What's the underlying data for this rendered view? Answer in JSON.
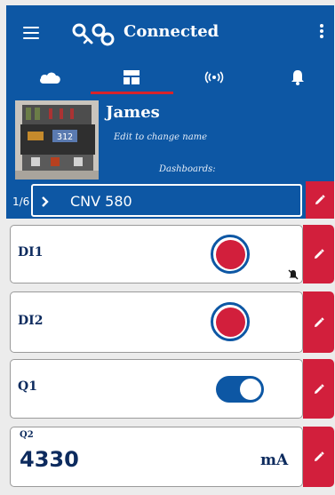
{
  "appbar": {
    "title": "Connected"
  },
  "tabs": [
    {
      "id": "cloud",
      "icon": "cloud-icon"
    },
    {
      "id": "dashboard",
      "icon": "dashboard-icon",
      "selected": true
    },
    {
      "id": "signal",
      "icon": "wireless-signal-icon"
    },
    {
      "id": "alerts",
      "icon": "bell-icon"
    }
  ],
  "device": {
    "name": "James",
    "edit_hint": "Edit to change name",
    "dashboards_label": "Dashboards:",
    "photo_display": "312"
  },
  "dashboard_selector": {
    "position": "1/6",
    "name": "CNV 580"
  },
  "widgets": {
    "di1": {
      "label": "DI1",
      "state": "on",
      "alarm_muted": true
    },
    "di2": {
      "label": "DI2",
      "state": "on"
    },
    "q1": {
      "label": "Q1",
      "toggle_on": true
    },
    "q2": {
      "label": "Q2",
      "value": "4330",
      "unit": "mA"
    }
  },
  "colors": {
    "primary": "#0d57a4",
    "accent": "#d21f3c",
    "tab_indicator": "#d8232a",
    "card_text": "#0d2b5e"
  }
}
